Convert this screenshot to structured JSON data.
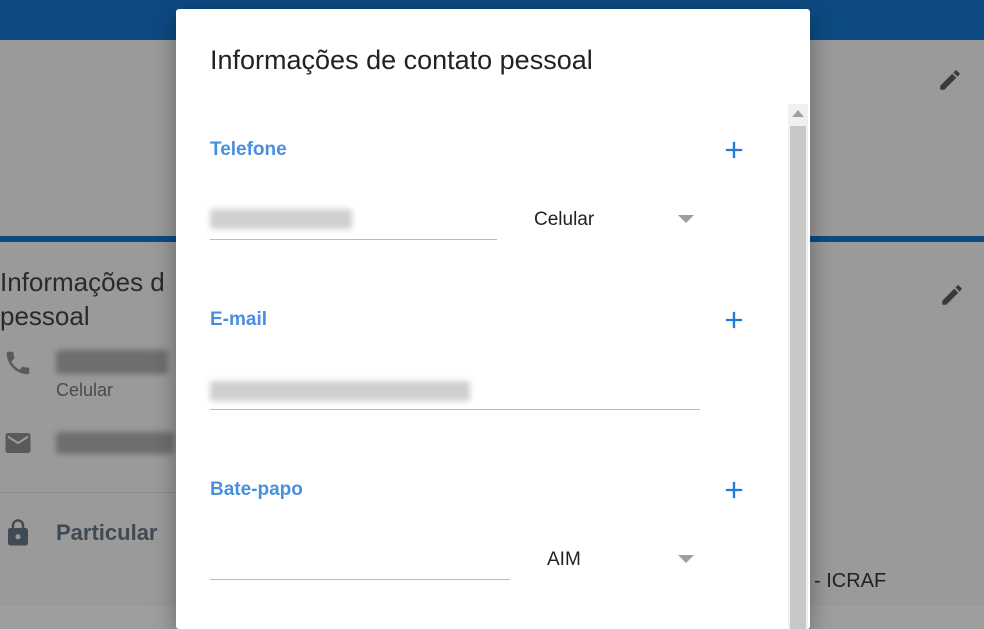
{
  "background": {
    "card_title_line1": "Informações d",
    "card_title_line2": "pessoal",
    "phone_type": "Celular",
    "privacy_label": "Particular",
    "footer_text": "- ICRAF"
  },
  "dialog": {
    "title": "Informações de contato pessoal",
    "phone": {
      "label": "Telefone",
      "type_selected": "Celular"
    },
    "email": {
      "label": "E-mail"
    },
    "chat": {
      "label": "Bate-papo",
      "service_selected": "AIM",
      "value": ""
    }
  },
  "icons": {
    "edit": "pencil-icon",
    "add": "plus-icon",
    "phone": "phone-icon",
    "email": "envelope-icon",
    "lock": "lock-icon"
  },
  "colors": {
    "accent": "#4a8fdf",
    "plus": "#1e7bd8",
    "header": "#0d4a82"
  }
}
